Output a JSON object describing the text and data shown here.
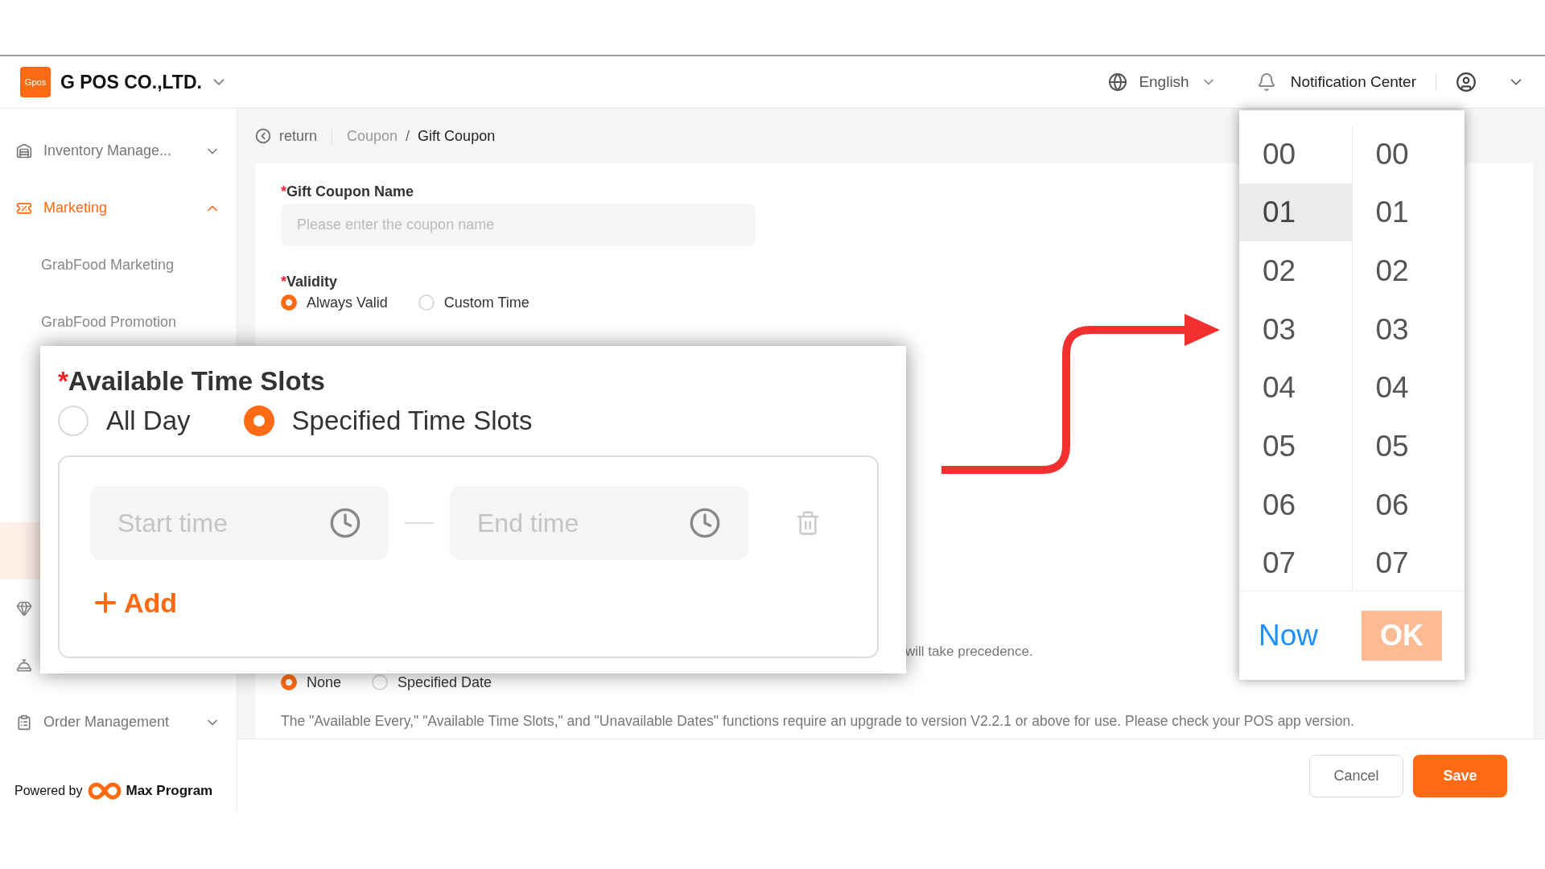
{
  "header": {
    "logo_text": "Gpos",
    "company": "G POS CO.,LTD.",
    "language": "English",
    "notification": "Notification Center"
  },
  "sidebar": {
    "items": [
      {
        "kind": "group",
        "label": "Inventory Manage...",
        "expanded": false,
        "selected": false
      },
      {
        "kind": "group",
        "label": "Marketing",
        "expanded": true,
        "selected": true
      },
      {
        "kind": "sub",
        "label": "GrabFood Marketing",
        "selected": false
      },
      {
        "kind": "sub",
        "label": "GrabFood Promotion",
        "selected": false
      },
      {
        "kind": "covered",
        "selected": true
      },
      {
        "kind": "icon_only",
        "selected": false
      },
      {
        "kind": "icon_only",
        "selected": false
      },
      {
        "kind": "group",
        "label": "Order Management",
        "expanded": false,
        "selected": false
      }
    ],
    "powered_by": "Powered by",
    "brand": "Max Program"
  },
  "breadcrumb": {
    "back": "return",
    "separator": "/",
    "items": [
      "Coupon",
      "Gift Coupon"
    ]
  },
  "form": {
    "required_mark": "*",
    "name_label": "Gift Coupon Name",
    "name_placeholder": "Please enter the coupon name",
    "validity_label": "Validity",
    "validity_options": [
      {
        "label": "Always Valid",
        "selected": true
      },
      {
        "label": "Custom Time",
        "selected": false
      }
    ],
    "hint_tail": "will take precedence.",
    "date_options": [
      {
        "label": "None",
        "selected": true
      },
      {
        "label": "Specified Date",
        "selected": false
      }
    ],
    "note": "The \"Available Every,\" \"Available Time Slots,\" and \"Unavailable Dates\" functions require an upgrade to version V2.2.1 or above for use. Please check your POS app version."
  },
  "footer": {
    "cancel": "Cancel",
    "save": "Save"
  },
  "callout": {
    "required_mark": "*",
    "title": "Available Time Slots",
    "options": [
      {
        "label": "All Day",
        "selected": false
      },
      {
        "label": "Specified Time Slots",
        "selected": true
      }
    ],
    "slots": [
      {
        "start_placeholder": "Start time",
        "end_placeholder": "End time"
      }
    ],
    "add_label": "Add"
  },
  "time_picker": {
    "hours": [
      {
        "label": "00",
        "selected": false
      },
      {
        "label": "01",
        "selected": true
      },
      {
        "label": "02",
        "selected": false
      },
      {
        "label": "03",
        "selected": false
      },
      {
        "label": "04",
        "selected": false
      },
      {
        "label": "05",
        "selected": false
      },
      {
        "label": "06",
        "selected": false
      },
      {
        "label": "07",
        "selected": false
      }
    ],
    "minutes": [
      "00",
      "01",
      "02",
      "03",
      "04",
      "05",
      "06",
      "07"
    ],
    "now": "Now",
    "ok": {
      "label": "OK",
      "disabled": true
    }
  }
}
